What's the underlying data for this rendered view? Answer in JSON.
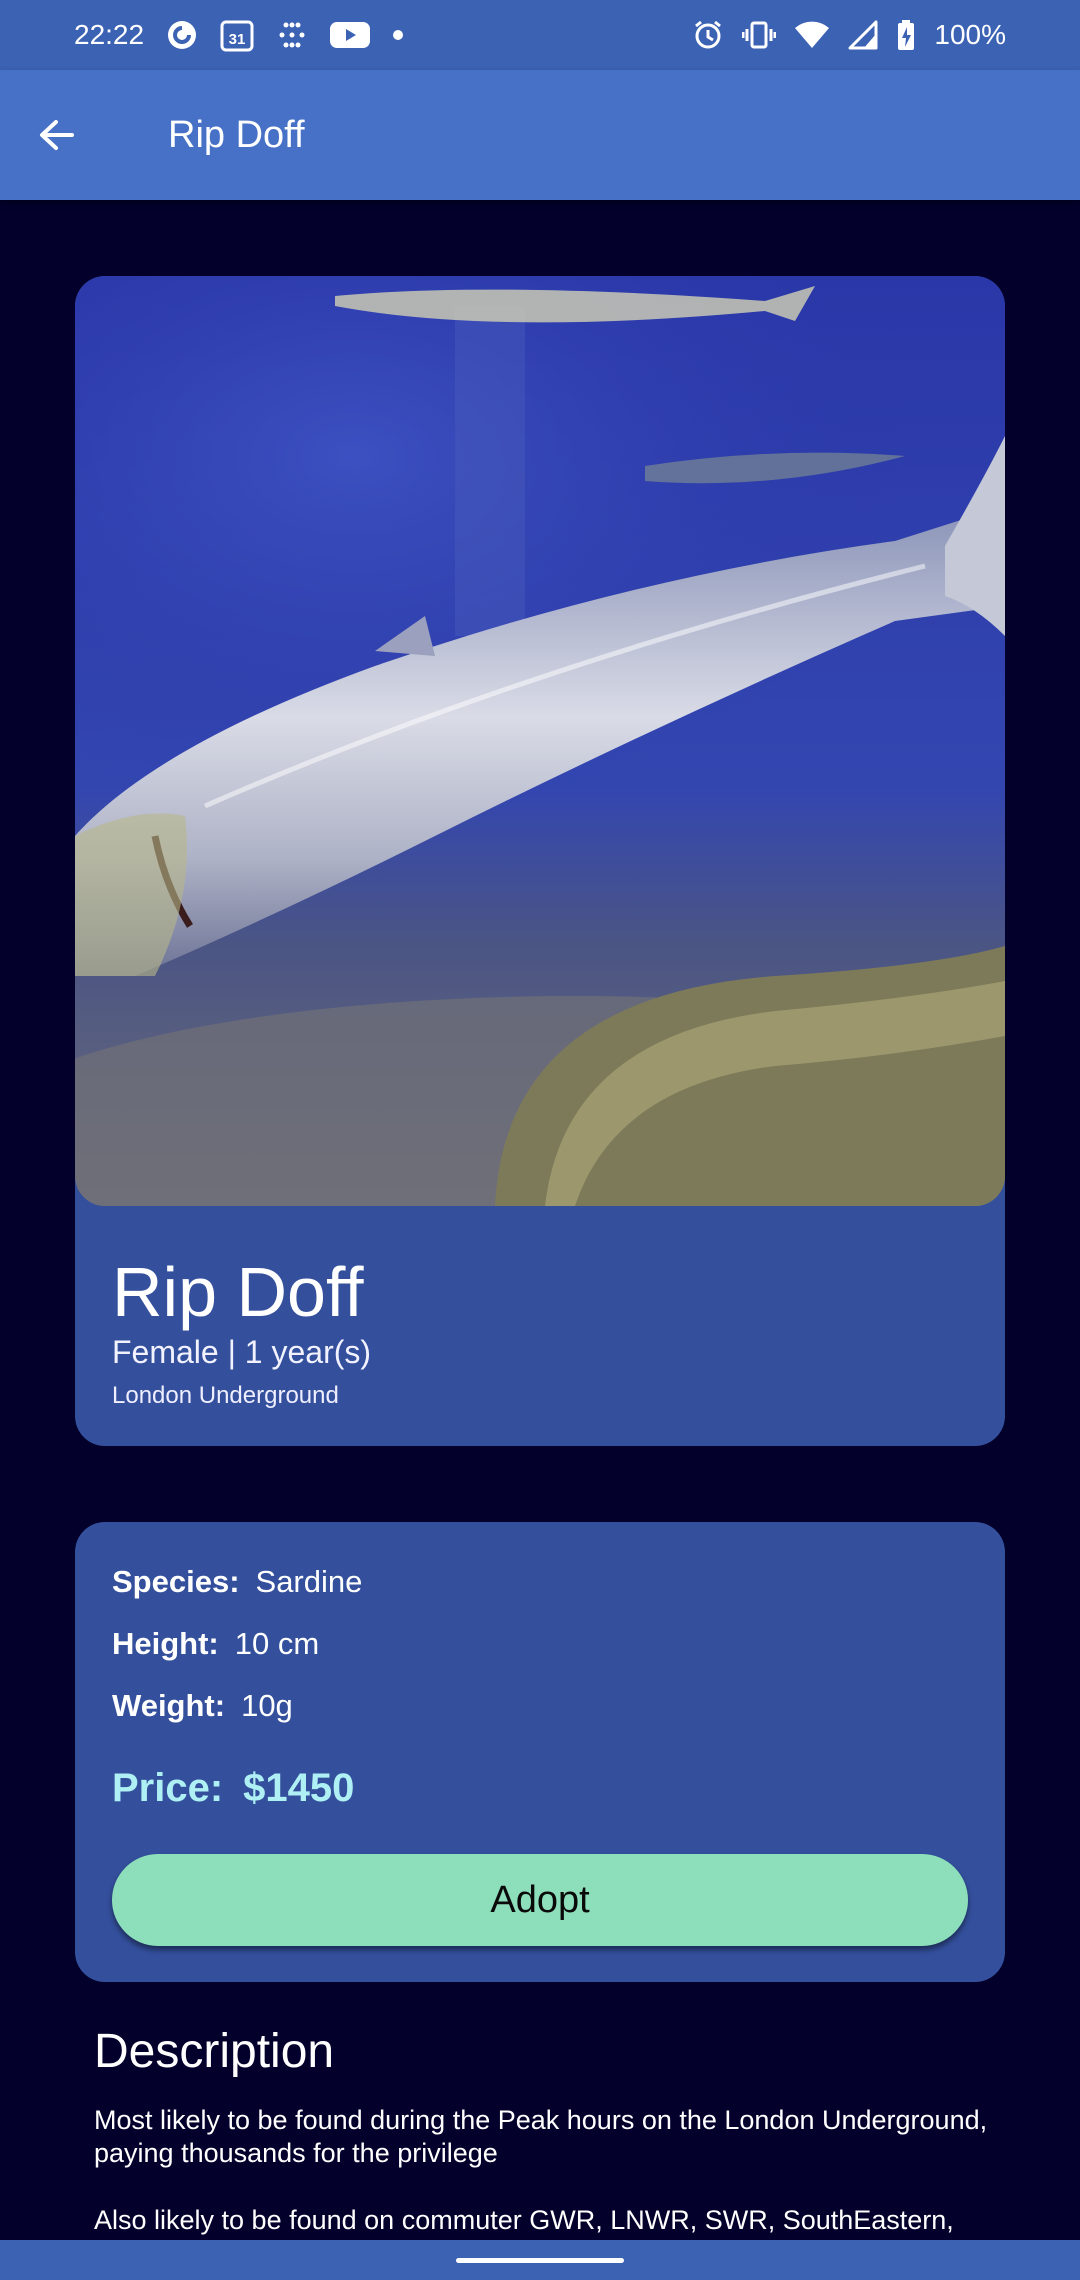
{
  "status_bar": {
    "time": "22:22",
    "calendar_day": "31",
    "battery": "100%"
  },
  "app_bar": {
    "title": "Rip Doff"
  },
  "pet": {
    "name": "Rip Doff",
    "meta": "Female | 1 year(s)",
    "location": "London Underground"
  },
  "details": {
    "species_label": "Species:",
    "species_value": "Sardine",
    "height_label": "Height:",
    "height_value": "10 cm",
    "weight_label": "Weight:",
    "weight_value": "10g",
    "price_label": "Price:",
    "price_value": "$1450",
    "adopt_label": "Adopt"
  },
  "description": {
    "title": "Description",
    "paragraph1": "Most likely to be found during the Peak hours on the London Underground, paying thousands for the privilege",
    "paragraph2": "Also likely to be found on commuter GWR, LNWR, SWR, SouthEastern,"
  },
  "colors": {
    "status_bar": "#3c62b4",
    "app_bar": "#4671c6",
    "background": "#03002b",
    "card": "#34509d",
    "price": "#aef0f4",
    "adopt_button": "#8cdfba"
  }
}
